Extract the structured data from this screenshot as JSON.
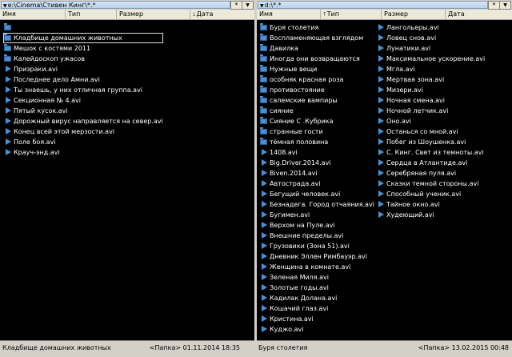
{
  "left": {
    "path": "e:\\Cinema\\Стивен Кинг\\*.*",
    "star": "*",
    "columns": {
      "name": "Имя",
      "type": "Тип",
      "size": "Размер",
      "date": "Дата"
    },
    "sort_marker": "🡓",
    "items": [
      {
        "icon": "folder-up-icon",
        "label": ""
      },
      {
        "icon": "folder-icon",
        "label": "Кладбище домашних животных"
      },
      {
        "icon": "folder-icon",
        "label": "Мешок с костями 2011"
      },
      {
        "icon": "folder-icon",
        "label": "Калейдоскоп ужасов"
      },
      {
        "icon": "video-file-icon",
        "label": "Призраки.avi"
      },
      {
        "icon": "video-file-icon",
        "label": "Последнее дело Амни.avi"
      },
      {
        "icon": "video-file-icon",
        "label": "Ты знаешь, у них отличная группа.avi"
      },
      {
        "icon": "video-file-icon",
        "label": "Секционная № 4.avi"
      },
      {
        "icon": "video-file-icon",
        "label": "Пятый кусок.avi"
      },
      {
        "icon": "video-file-icon",
        "label": "Дорожный вирус направляется на север.avi"
      },
      {
        "icon": "video-file-icon",
        "label": "Конец всей этой мерзости.avi"
      },
      {
        "icon": "video-file-icon",
        "label": "Поле боя.avi"
      },
      {
        "icon": "video-file-icon",
        "label": "Крауч-энд.avi"
      }
    ],
    "status": {
      "name": "Кладбище домашних животных",
      "info": "<Папка> 01.11.2014 18:35"
    }
  },
  "right": {
    "path": "d:\\*.*",
    "star": "*",
    "columns": {
      "name": "Имя",
      "type": "Тип",
      "size": "Размер",
      "date": "Дата"
    },
    "sort_marker": "🡑",
    "col1": [
      {
        "icon": "folder-icon",
        "label": "Буря столетия"
      },
      {
        "icon": "folder-icon",
        "label": "Воспламеняющая взглядом"
      },
      {
        "icon": "folder-icon",
        "label": "Давилка"
      },
      {
        "icon": "folder-icon",
        "label": "Иногда они возвращаются"
      },
      {
        "icon": "folder-icon",
        "label": "Нужные вещи"
      },
      {
        "icon": "folder-icon",
        "label": "особняк красная роза"
      },
      {
        "icon": "folder-icon",
        "label": "противостояние"
      },
      {
        "icon": "folder-icon",
        "label": "салемские вампиры"
      },
      {
        "icon": "folder-icon",
        "label": "сияние"
      },
      {
        "icon": "folder-icon",
        "label": "Сияние С .Кубрика"
      },
      {
        "icon": "folder-icon",
        "label": "странные гости"
      },
      {
        "icon": "folder-icon",
        "label": "тёмная половина"
      },
      {
        "icon": "video-file-icon",
        "label": "1408.avi"
      },
      {
        "icon": "video-file-icon",
        "label": "Big.Driver.2014.avi"
      },
      {
        "icon": "video-file-icon",
        "label": "Biven.2014.avi"
      },
      {
        "icon": "video-file-icon",
        "label": "Автострада.avi"
      },
      {
        "icon": "video-file-icon",
        "label": "Бегущий человек.avi"
      },
      {
        "icon": "video-file-icon",
        "label": "Безнадега. Город отчаяния.avi"
      },
      {
        "icon": "video-file-icon",
        "label": "Бугимен.avi"
      },
      {
        "icon": "video-file-icon",
        "label": "Верхом на Пуле.avi"
      },
      {
        "icon": "video-file-icon",
        "label": "Внешние пределы.avi"
      },
      {
        "icon": "video-file-icon",
        "label": "Грузовики (Зона 51).avi"
      },
      {
        "icon": "video-file-icon",
        "label": "Дневник Эллен Римбауэр.avi"
      },
      {
        "icon": "video-file-icon",
        "label": "Женщина в комнате.avi"
      },
      {
        "icon": "video-file-icon",
        "label": "Зеленая Миля.avi"
      },
      {
        "icon": "video-file-icon",
        "label": "Золотые годы.avi"
      },
      {
        "icon": "video-file-icon",
        "label": "Кадилак Долана.avi"
      },
      {
        "icon": "video-file-icon",
        "label": "Кошачий глаз.avi"
      },
      {
        "icon": "video-file-icon",
        "label": "Кристина.avi"
      },
      {
        "icon": "video-file-icon",
        "label": "Куджо.avi"
      }
    ],
    "col2": [
      {
        "icon": "video-file-icon",
        "label": "Лангольеры.avi"
      },
      {
        "icon": "video-file-icon",
        "label": "Ловец снов.avi"
      },
      {
        "icon": "video-file-icon",
        "label": "Лунатики.avi"
      },
      {
        "icon": "video-file-icon",
        "label": "Максимальное ускорение.avi"
      },
      {
        "icon": "video-file-icon",
        "label": "Мгла.avi"
      },
      {
        "icon": "video-file-icon",
        "label": "Мертвая зона.avi"
      },
      {
        "icon": "video-file-icon",
        "label": "Мизери.avi"
      },
      {
        "icon": "video-file-icon",
        "label": "Ночная смена.avi"
      },
      {
        "icon": "video-file-icon",
        "label": "Ночной летчик.avi"
      },
      {
        "icon": "video-file-icon",
        "label": "Оно.avi"
      },
      {
        "icon": "video-file-icon",
        "label": "Останься со мной.avi"
      },
      {
        "icon": "video-file-icon",
        "label": "Побег из Шоушенка.avi"
      },
      {
        "icon": "video-file-icon",
        "label": "С. Кинг. Свет из темноты.avi"
      },
      {
        "icon": "video-file-icon",
        "label": "Сердца в Атлантиде.avi"
      },
      {
        "icon": "video-file-icon",
        "label": "Серебряная пуля.avi"
      },
      {
        "icon": "video-file-icon",
        "label": "Сказки темной стороны.avi"
      },
      {
        "icon": "video-file-icon",
        "label": "Способный ученик.avi"
      },
      {
        "icon": "video-file-icon",
        "label": "Тайное окно.avi"
      },
      {
        "icon": "video-file-icon",
        "label": "Худеющий.avi"
      }
    ],
    "status": {
      "name": "Буря столетия",
      "info": "<Папка> 13.02.2015 00:48"
    }
  },
  "colors": {
    "list_bg": "#000000",
    "list_text": "#ffffff",
    "icon": "#4a90d0",
    "chrome": "#d4d0c8"
  }
}
